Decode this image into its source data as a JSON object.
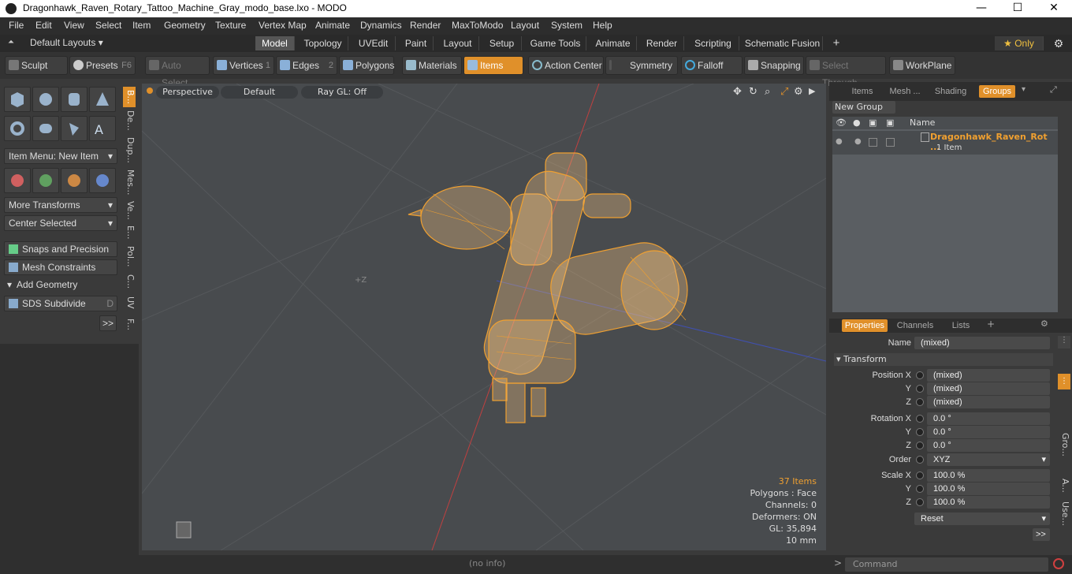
{
  "window": {
    "title": "Dragonhawk_Raven_Rotary_Tattoo_Machine_Gray_modo_base.lxo - MODO",
    "minimize": "—",
    "maximize": "☐",
    "close": "✕"
  },
  "menu": [
    "File",
    "Edit",
    "View",
    "Select",
    "Item",
    "Geometry",
    "Texture",
    "Vertex Map",
    "Animate",
    "Dynamics",
    "Render",
    "MaxToModo",
    "Layout",
    "System",
    "Help"
  ],
  "layouts": {
    "selector": "Default Layouts ▾",
    "tabs": [
      "Model",
      "Topology",
      "UVEdit",
      "Paint",
      "Layout",
      "Setup",
      "Game Tools",
      "Animate",
      "Render",
      "Scripting",
      "Schematic Fusion"
    ],
    "add": "+",
    "only": "★ Only",
    "gear": "⚙"
  },
  "toolbar": {
    "sculpt": "Sculpt",
    "presets": "Presets",
    "presets_key": "F6",
    "auto_select": "Auto Select",
    "vertices": "Vertices",
    "vertices_key": "1",
    "edges": "Edges",
    "edges_key": "2",
    "polygons": "Polygons",
    "materials": "Materials",
    "items": "Items",
    "action_center": "Action Center",
    "symmetry": "Symmetry",
    "falloff": "Falloff",
    "snapping": "Snapping",
    "select_through": "Select Through",
    "workplane": "WorkPlane"
  },
  "left": {
    "item_menu": "Item Menu: New Item",
    "more_transforms": "More Transforms",
    "center_selected": "Center Selected",
    "snaps": "Snaps and Precision",
    "mesh_constraints": "Mesh Constraints",
    "add_geometry": "Add Geometry",
    "sds": "SDS Subdivide",
    "sds_key": "D",
    "more": ">>",
    "vtabs": [
      "B...",
      "De...",
      "Dup...",
      "Mes...",
      "Ve...",
      "E...",
      "Pol...",
      "C...",
      "UV",
      "F..."
    ]
  },
  "viewport": {
    "view": "Perspective",
    "shading": "Default",
    "raygl": "Ray GL: Off",
    "axis_label": "+Z",
    "stats": {
      "items": "37 Items",
      "polygons": "Polygons : Face",
      "channels": "Channels: 0",
      "deformers": "Deformers: ON",
      "gl": "GL: 35,894",
      "scale": "10 mm"
    }
  },
  "groups": {
    "tabs": [
      "Items",
      "Mesh ...",
      "Shading",
      "Groups"
    ],
    "new_group": "New Group",
    "col_name": "Name",
    "row_name": "Dragonhawk_Raven_Rot ...",
    "row_count": "1 Item"
  },
  "properties": {
    "tabs": [
      "Properties",
      "Channels",
      "Lists"
    ],
    "name_label": "Name",
    "name_value": "(mixed)",
    "transform": "Transform",
    "position_x": "Position X",
    "rotation_x": "Rotation X",
    "scale_x": "Scale X",
    "y": "Y",
    "z": "Z",
    "pos": [
      "(mixed)",
      "(mixed)",
      "(mixed)"
    ],
    "rot": [
      "0.0 °",
      "0.0 °",
      "0.0 °"
    ],
    "scale": [
      "100.0 %",
      "100.0 %",
      "100.0 %"
    ],
    "order_label": "Order",
    "order_value": "XYZ",
    "reset": "Reset",
    "more": ">>",
    "side_tabs": [
      "Gro...",
      "A...",
      "Use..."
    ]
  },
  "status": {
    "info": "(no info)",
    "command": "Command"
  },
  "colors": {
    "accent": "#e0902a",
    "wire": "#f0a030",
    "viewport": "#484b4e"
  }
}
